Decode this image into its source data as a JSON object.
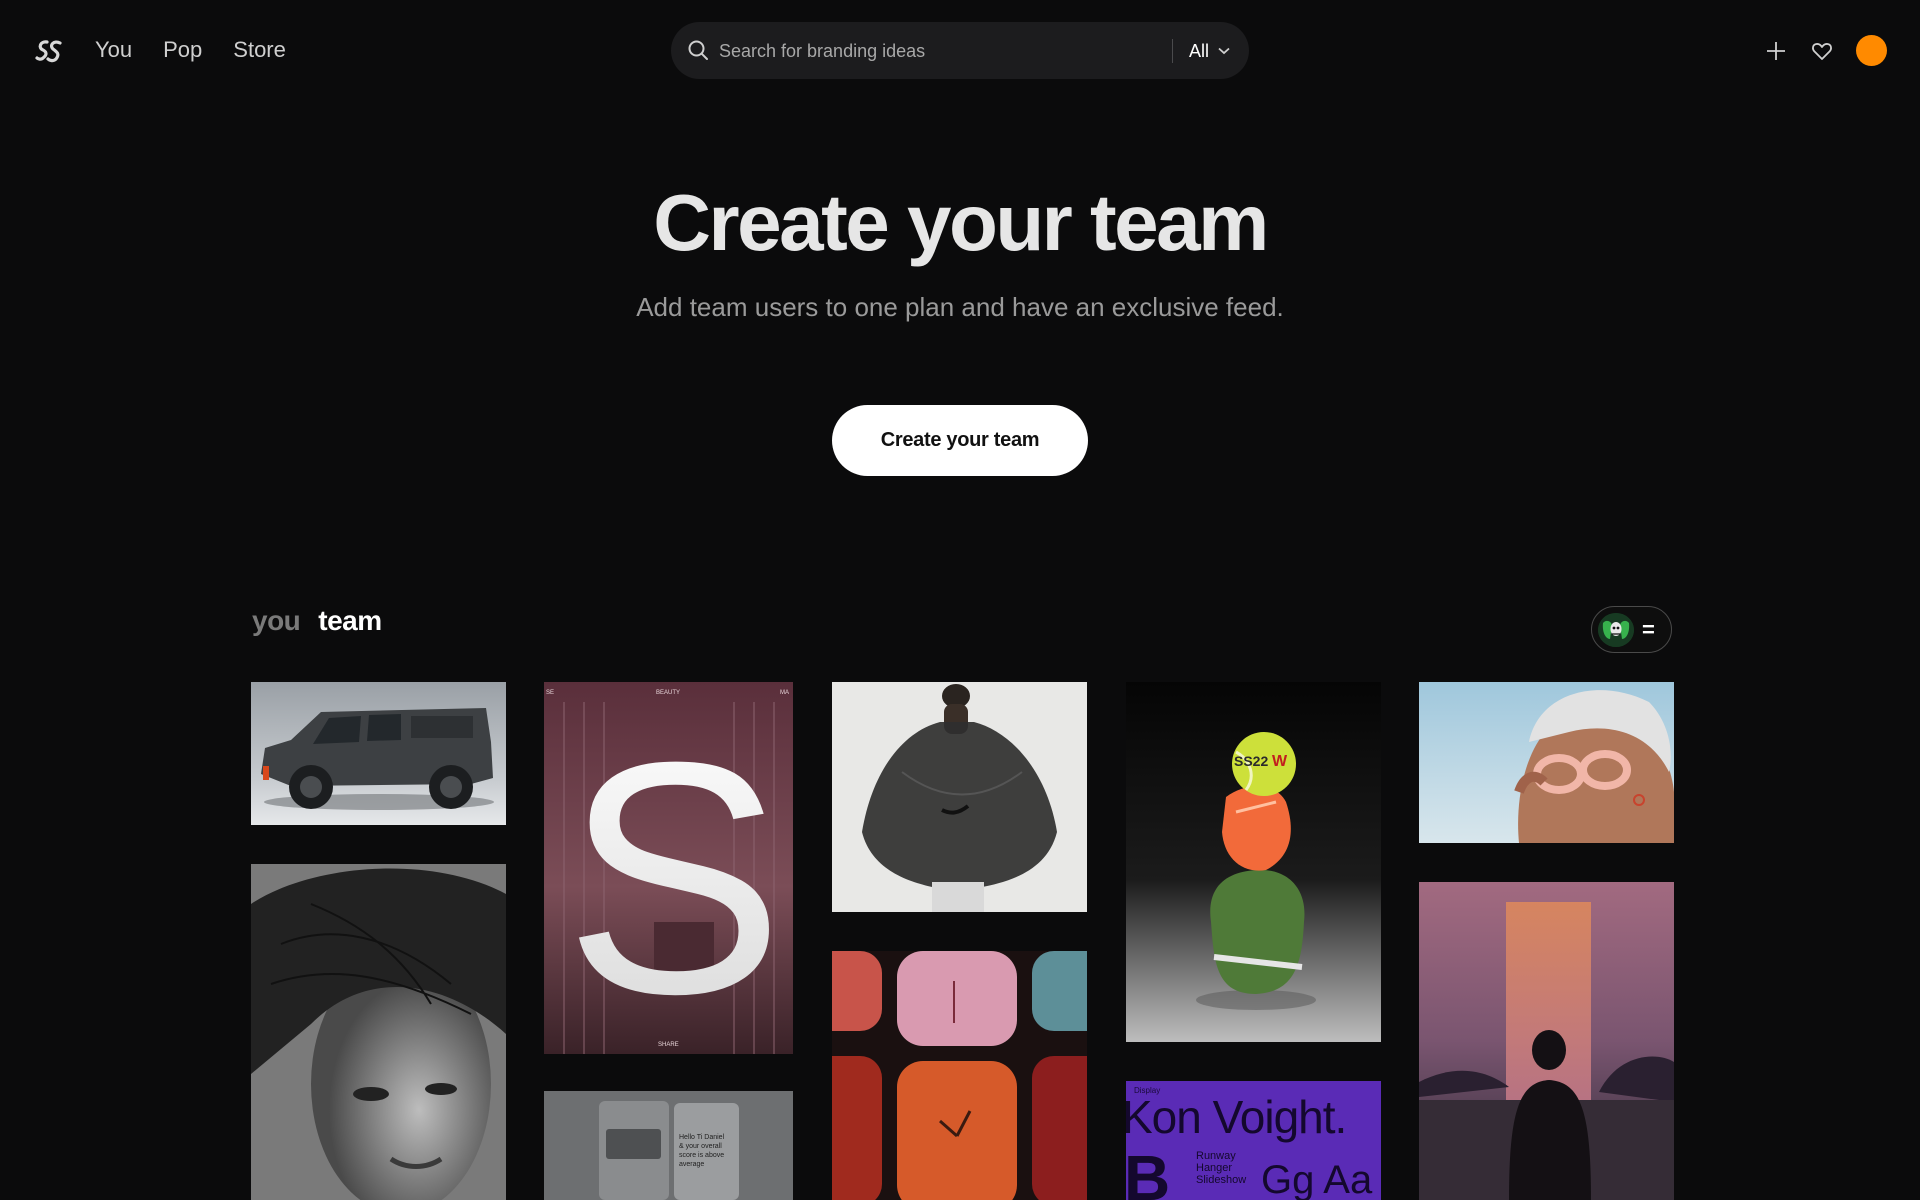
{
  "nav": {
    "logo": "SS",
    "links": [
      "You",
      "Pop",
      "Store"
    ]
  },
  "search": {
    "placeholder": "Search for branding ideas",
    "filter_label": "All"
  },
  "header_icons": [
    "plus-icon",
    "heart-icon",
    "avatar"
  ],
  "hero": {
    "title": "Create your team",
    "subtitle": "Add team users to one plan and have an exclusive feed.",
    "cta_label": "Create your team"
  },
  "feed": {
    "tabs": [
      "you",
      "team"
    ],
    "active_tab": "team",
    "switch_label": "="
  },
  "tiles": {
    "s_poster": {
      "top_left": "SE",
      "top_center": "BEAUTY",
      "top_right": "MA",
      "bottom": "SHARE",
      "letter": "S"
    },
    "tennis_ball": {
      "text": "SS22"
    },
    "type_specimen": {
      "small": "Display",
      "headline": "Kon Voight.",
      "line1": "Runway",
      "line2": "Hanger",
      "line3": "Slideshow",
      "glyphs": "Gg Aa",
      "big_letter": "B"
    },
    "app_screen": {
      "text1": "Hello Ti Daniel",
      "text2": "& your overall",
      "text3": "score is above",
      "text4": "average"
    }
  },
  "colors": {
    "background": "#0b0b0c",
    "accent_avatar": "#ff8a00",
    "search_bg": "#1c1c1e"
  }
}
